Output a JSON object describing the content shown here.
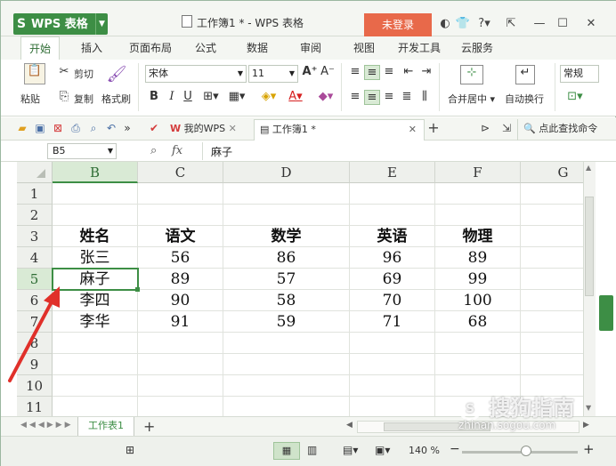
{
  "app": {
    "logo": "WPS 表格",
    "window_title": "工作簿1 * - WPS 表格",
    "login": "未登录",
    "help": "?"
  },
  "ribbon_tabs": [
    "开始",
    "插入",
    "页面布局",
    "公式",
    "数据",
    "审阅",
    "视图",
    "开发工具",
    "云服务"
  ],
  "ribbon": {
    "paste": "粘贴",
    "cut": "剪切",
    "copy": "复制",
    "format_painter": "格式刷",
    "font_name": "宋体",
    "font_size": "11",
    "merge_center": "合并居中",
    "wrap_text": "自动换行",
    "number_format": "常规",
    "bold": "B",
    "italic": "I",
    "underline": "U"
  },
  "doc_tabs": {
    "my_wps": "我的WPS",
    "workbook": "工作簿1 *",
    "search": "点此查找命令"
  },
  "formula_bar": {
    "name_box": "B5",
    "fx": "fx",
    "value": "麻子"
  },
  "columns": [
    "B",
    "C",
    "D",
    "E",
    "F",
    "G"
  ],
  "rows": [
    "1",
    "2",
    "3",
    "4",
    "5",
    "6",
    "7",
    "8",
    "9",
    "10",
    "11"
  ],
  "cells": {
    "r3": [
      "姓名",
      "语文",
      "数学",
      "英语",
      "物理",
      ""
    ],
    "r4": [
      "张三",
      "56",
      "86",
      "96",
      "89",
      ""
    ],
    "r5": [
      "麻子",
      "89",
      "57",
      "69",
      "99",
      ""
    ],
    "r6": [
      "李四",
      "90",
      "58",
      "70",
      "100",
      ""
    ],
    "r7": [
      "李华",
      "91",
      "59",
      "71",
      "68",
      ""
    ]
  },
  "sheet_tab": "工作表1",
  "status": {
    "zoom": "140 %"
  },
  "watermark": {
    "brand": "搜狗指南",
    "url": "zhinan.sogou.com"
  },
  "colors": {
    "accent": "#3d8e45",
    "login": "#e8694a",
    "arrow": "#e0302a"
  }
}
